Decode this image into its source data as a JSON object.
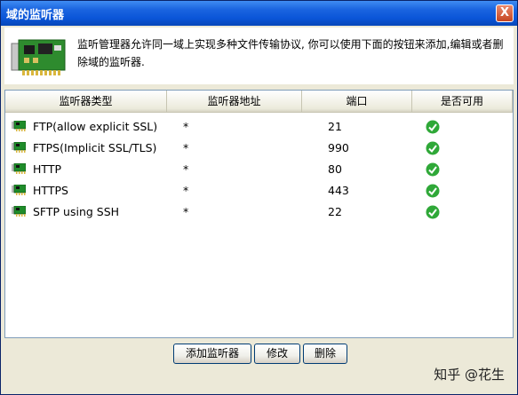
{
  "window": {
    "title": "域的监听器",
    "close_label": "X"
  },
  "header": {
    "description": "监听管理器允许同一域上实现多种文件传输协议, 你可以使用下面的按钮来添加,编辑或者删除域的监听器."
  },
  "table": {
    "columns": [
      "监听器类型",
      "监听器地址",
      "端口",
      "是否可用"
    ],
    "rows": [
      {
        "type": "FTP(allow explicit SSL)",
        "address": "*",
        "port": "21",
        "enabled_icon": "check-icon"
      },
      {
        "type": "FTPS(Implicit SSL/TLS)",
        "address": "*",
        "port": "990",
        "enabled_icon": "check-icon"
      },
      {
        "type": "HTTP",
        "address": "*",
        "port": "80",
        "enabled_icon": "check-icon"
      },
      {
        "type": "HTTPS",
        "address": "*",
        "port": "443",
        "enabled_icon": "check-icon"
      },
      {
        "type": "SFTP using SSH",
        "address": "*",
        "port": "22",
        "enabled_icon": "check-icon"
      }
    ]
  },
  "buttons": {
    "add": "添加监听器",
    "edit": "修改",
    "delete": "删除"
  },
  "watermark": "知乎 @花生",
  "colors": {
    "title_bar": "#0a55d8",
    "window_bg": "#ece9d8",
    "check_green": "#2fa838",
    "card_green": "#1f8c2a"
  }
}
